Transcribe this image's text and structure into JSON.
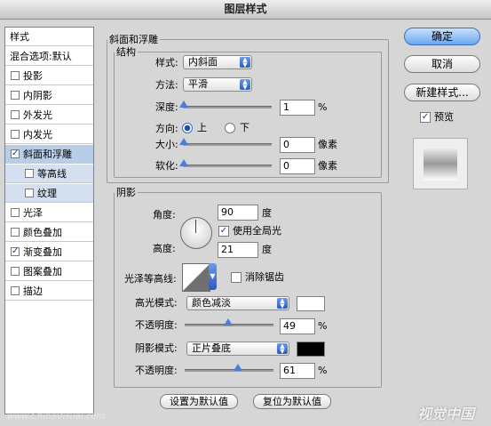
{
  "window": {
    "title": "图层样式"
  },
  "styles_list": {
    "header": "样式",
    "blend_options": "混合选项:默认",
    "items": [
      {
        "label": "投影",
        "checked": false
      },
      {
        "label": "内阴影",
        "checked": false
      },
      {
        "label": "外发光",
        "checked": false
      },
      {
        "label": "内发光",
        "checked": false
      },
      {
        "label": "斜面和浮雕",
        "checked": true,
        "selected": true
      },
      {
        "label": "等高线",
        "checked": false,
        "sub": true
      },
      {
        "label": "纹理",
        "checked": false,
        "sub": true
      },
      {
        "label": "光泽",
        "checked": false
      },
      {
        "label": "颜色叠加",
        "checked": false
      },
      {
        "label": "渐变叠加",
        "checked": true
      },
      {
        "label": "图案叠加",
        "checked": false
      },
      {
        "label": "描边",
        "checked": false
      }
    ]
  },
  "bevel": {
    "group_title": "斜面和浮雕",
    "structure_title": "结构",
    "style_label": "样式:",
    "style_value": "内斜面",
    "technique_label": "方法:",
    "technique_value": "平滑",
    "depth_label": "深度:",
    "depth_value": "1",
    "depth_unit": "%",
    "direction_label": "方向:",
    "direction_up": "上",
    "direction_down": "下",
    "direction_selected": "上",
    "size_label": "大小:",
    "size_value": "0",
    "size_unit": "像素",
    "soften_label": "软化:",
    "soften_value": "0",
    "soften_unit": "像素"
  },
  "shading": {
    "title": "阴影",
    "angle_label": "角度:",
    "angle_value": "90",
    "angle_unit": "度",
    "global_light_label": "使用全局光",
    "global_light_checked": true,
    "altitude_label": "高度:",
    "altitude_value": "21",
    "altitude_unit": "度",
    "gloss_contour_label": "光泽等高线:",
    "anti_alias_label": "消除锯齿",
    "anti_alias_checked": false,
    "highlight_mode_label": "高光模式:",
    "highlight_mode_value": "颜色减淡",
    "highlight_color": "#ffffff",
    "highlight_opacity_label": "不透明度:",
    "highlight_opacity_value": "49",
    "highlight_opacity_unit": "%",
    "shadow_mode_label": "阴影模式:",
    "shadow_mode_value": "正片叠底",
    "shadow_color": "#000000",
    "shadow_opacity_label": "不透明度:",
    "shadow_opacity_value": "61",
    "shadow_opacity_unit": "%"
  },
  "footer_buttons": {
    "make_default": "设置为默认值",
    "reset_default": "复位为默认值"
  },
  "side_buttons": {
    "ok": "确定",
    "cancel": "取消",
    "new_style": "新建样式...",
    "preview_label": "预览",
    "preview_checked": true
  },
  "watermark": {
    "left": "www.ChinaVisual.com",
    "right": "视觉中国"
  }
}
